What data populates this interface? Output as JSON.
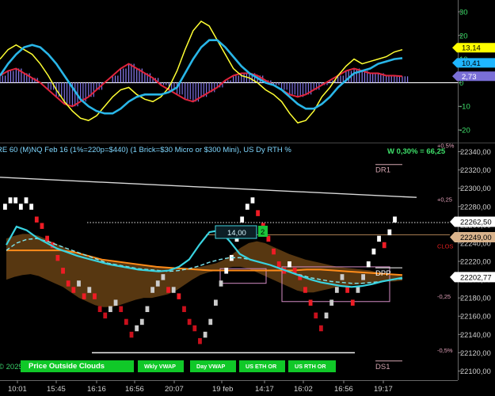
{
  "oscillator": {
    "y_ticks": [
      30,
      20,
      10,
      0,
      -10,
      -20
    ],
    "y_tick_labels": [
      "30",
      "20",
      "10",
      "0",
      "-10",
      "-20"
    ],
    "ylim": [
      -24,
      33
    ],
    "badges": [
      {
        "label": "13,14",
        "value": 13.14,
        "color": "#ffff00",
        "text_color": "#000000"
      },
      {
        "label": "10,41",
        "value": 10.41,
        "color": "#1fb6ff",
        "text_color": "#000000"
      },
      {
        "label": "2,73",
        "value": 2.73,
        "color": "#7a6fd6",
        "text_color": "#ffffff"
      }
    ]
  },
  "price_chart": {
    "title": "RE 60 (M)NQ Feb 16  (1%=220p=$440) (1 Brick=$30 Micro or $300 Mini), US Dy RTH %",
    "stat": "W 0,30% = 66,25",
    "y_ticks": [
      22340,
      22320,
      22300,
      22280,
      22260,
      22240,
      22220,
      22200,
      22180,
      22160,
      22140,
      22120,
      22100
    ],
    "y_tick_labels": [
      "22340,00",
      "22320,00",
      "22300,00",
      "22280,00",
      "22260,00",
      "22240,00",
      "22220,00",
      "22200,00",
      "22180,00",
      "22160,00",
      "22140,00",
      "22120,00",
      "22100,00"
    ],
    "ylim": [
      22090,
      22350
    ],
    "price_badges": [
      {
        "label": "22262,50",
        "value": 22262.5,
        "color": "#ffffff",
        "text_color": "#000000"
      },
      {
        "label": "22249,00",
        "value": 22249,
        "color": "#d9b38c",
        "text_color": "#000000"
      },
      {
        "label": "22202,77",
        "value": 22202.77,
        "color": "#ffffff",
        "text_color": "#000000"
      }
    ],
    "levels": [
      {
        "label": "DR1",
        "value": 22326,
        "color": "#d4a5b0"
      },
      {
        "label": "DPP",
        "value": 22213,
        "color": "#ffffff"
      },
      {
        "label": "DS1",
        "value": 22111,
        "color": "#d4a5b0"
      }
    ],
    "pct_labels": [
      {
        "label": "+0,5%",
        "value": 22347
      },
      {
        "label": "+0,25",
        "value": 22288
      },
      {
        "label": "CLOS",
        "value": 22237
      },
      {
        "label": "-0,25",
        "value": 22182
      },
      {
        "label": "-0,5%",
        "value": 22123
      }
    ],
    "box_label": "14,00",
    "green_tag": "2",
    "watermark": "© 2025 Ninja Trader, LLC"
  },
  "time_axis": [
    "10:01",
    "15:45",
    "16:16",
    "16:56",
    "20:07",
    "19 feb",
    "14:17",
    "16:02",
    "16:56",
    "19:17"
  ],
  "bottom_buttons": [
    "Price Outside Clouds",
    "Wkly VWAP",
    "Day VWAP",
    "US ETH OR",
    "US RTH OR"
  ],
  "chart_data": [
    {
      "type": "line",
      "title": "",
      "x": [
        0,
        1,
        2,
        3,
        4,
        5,
        6,
        7,
        8,
        9,
        10,
        11,
        12,
        13,
        14,
        15,
        16,
        17,
        18,
        19,
        20,
        21,
        22,
        23,
        24,
        25,
        26,
        27,
        28,
        29,
        30,
        31,
        32,
        33,
        34,
        35,
        36,
        37,
        38,
        39,
        40,
        41,
        42,
        43,
        44,
        45,
        46,
        47,
        48,
        49,
        50
      ],
      "series": [
        {
          "name": "",
          "color": "#ffff33",
          "values": [
            10,
            14,
            16,
            14,
            12,
            8,
            3,
            -3,
            -8,
            -12,
            -15,
            -16,
            -14,
            -10,
            -6,
            -3,
            -2,
            -5,
            -7,
            -8,
            -6,
            -2,
            5,
            14,
            22,
            26,
            24,
            18,
            12,
            6,
            3,
            2,
            0,
            -3,
            -5,
            -8,
            -13,
            -17,
            -16,
            -12,
            -6,
            -2,
            3,
            7,
            10,
            8,
            9,
            10,
            11,
            13,
            14
          ]
        },
        {
          "name": "",
          "color": "#29b6e8",
          "values": [
            3,
            8,
            12,
            15,
            16,
            15,
            12,
            8,
            3,
            -2,
            -7,
            -10,
            -12,
            -13,
            -13,
            -11,
            -8,
            -6,
            -5,
            -5,
            -5,
            -4,
            -2,
            4,
            10,
            15,
            18,
            18,
            15,
            11,
            7,
            4,
            2,
            0,
            -1,
            -3,
            -6,
            -9,
            -11,
            -11,
            -9,
            -6,
            -2,
            1,
            4,
            5,
            6,
            8,
            9,
            10,
            10.4
          ]
        }
      ],
      "histogram": [
        3,
        5,
        6,
        4,
        2,
        0,
        -3,
        -6,
        -9,
        -10,
        -8,
        -6,
        -3,
        0,
        3,
        6,
        8,
        6,
        4,
        2,
        -1,
        -3,
        -5,
        -7,
        -8,
        -6,
        -4,
        -2,
        1,
        3,
        4,
        4,
        3,
        1,
        -1,
        -3,
        -5,
        -6,
        -5,
        -3,
        -1,
        1,
        3,
        5,
        6,
        5,
        4,
        4,
        3,
        3,
        2.7
      ],
      "ylim": [
        -24,
        33
      ]
    },
    {
      "type": "renko",
      "title": "RE 60 (M)NQ Feb 16  (1%=220p=$440) (1 Brick=$30 Micro or $300 Mini), US Dy RTH %",
      "brick_size": 7,
      "bricks": [
        {
          "x": 0,
          "low": 22276,
          "dir": "up"
        },
        {
          "x": 1,
          "low": 22283,
          "dir": "up"
        },
        {
          "x": 2,
          "low": 22283,
          "dir": "up"
        },
        {
          "x": 3,
          "low": 22276,
          "dir": "up"
        },
        {
          "x": 4,
          "low": 22283,
          "dir": "up"
        },
        {
          "x": 5,
          "low": 22276,
          "dir": "up"
        },
        {
          "x": 6,
          "low": 22262,
          "dir": "down"
        },
        {
          "x": 7,
          "low": 22255,
          "dir": "down"
        },
        {
          "x": 8,
          "low": 22241,
          "dir": "down"
        },
        {
          "x": 9,
          "low": 22234,
          "dir": "down"
        },
        {
          "x": 10,
          "low": 22220,
          "dir": "down"
        },
        {
          "x": 11,
          "low": 22206,
          "dir": "down"
        },
        {
          "x": 12,
          "low": 22192,
          "dir": "down"
        },
        {
          "x": 13,
          "low": 22185,
          "dir": "down"
        },
        {
          "x": 14,
          "low": 22192,
          "dir": "up"
        },
        {
          "x": 15,
          "low": 22178,
          "dir": "down"
        },
        {
          "x": 16,
          "low": 22185,
          "dir": "up"
        },
        {
          "x": 17,
          "low": 22178,
          "dir": "down"
        },
        {
          "x": 18,
          "low": 22164,
          "dir": "down"
        },
        {
          "x": 19,
          "low": 22157,
          "dir": "down"
        },
        {
          "x": 20,
          "low": 22164,
          "dir": "up"
        },
        {
          "x": 21,
          "low": 22171,
          "dir": "up"
        },
        {
          "x": 22,
          "low": 22164,
          "dir": "down"
        },
        {
          "x": 23,
          "low": 22150,
          "dir": "down"
        },
        {
          "x": 24,
          "low": 22136,
          "dir": "down"
        },
        {
          "x": 25,
          "low": 22143,
          "dir": "up"
        },
        {
          "x": 26,
          "low": 22150,
          "dir": "up"
        },
        {
          "x": 27,
          "low": 22164,
          "dir": "up"
        },
        {
          "x": 28,
          "low": 22185,
          "dir": "up"
        },
        {
          "x": 29,
          "low": 22192,
          "dir": "up"
        },
        {
          "x": 30,
          "low": 22199,
          "dir": "up"
        },
        {
          "x": 31,
          "low": 22185,
          "dir": "down"
        },
        {
          "x": 32,
          "low": 22185,
          "dir": "up"
        },
        {
          "x": 33,
          "low": 22178,
          "dir": "down"
        },
        {
          "x": 34,
          "low": 22164,
          "dir": "down"
        },
        {
          "x": 35,
          "low": 22150,
          "dir": "down"
        },
        {
          "x": 36,
          "low": 22143,
          "dir": "down"
        },
        {
          "x": 37,
          "low": 22129,
          "dir": "down"
        },
        {
          "x": 38,
          "low": 22136,
          "dir": "up"
        },
        {
          "x": 39,
          "low": 22150,
          "dir": "up"
        },
        {
          "x": 40,
          "low": 22171,
          "dir": "up"
        },
        {
          "x": 41,
          "low": 22192,
          "dir": "up"
        },
        {
          "x": 42,
          "low": 22206,
          "dir": "up"
        },
        {
          "x": 43,
          "low": 22220,
          "dir": "up"
        },
        {
          "x": 44,
          "low": 22241,
          "dir": "up"
        },
        {
          "x": 45,
          "low": 22262,
          "dir": "up"
        },
        {
          "x": 46,
          "low": 22276,
          "dir": "up"
        },
        {
          "x": 47,
          "low": 22283,
          "dir": "up"
        },
        {
          "x": 48,
          "low": 22269,
          "dir": "down"
        },
        {
          "x": 49,
          "low": 22255,
          "dir": "down"
        },
        {
          "x": 50,
          "low": 22241,
          "dir": "down"
        },
        {
          "x": 51,
          "low": 22227,
          "dir": "down"
        },
        {
          "x": 52,
          "low": 22213,
          "dir": "down"
        },
        {
          "x": 53,
          "low": 22206,
          "dir": "down"
        },
        {
          "x": 54,
          "low": 22213,
          "dir": "up"
        },
        {
          "x": 55,
          "low": 22206,
          "dir": "down"
        },
        {
          "x": 56,
          "low": 22199,
          "dir": "down"
        },
        {
          "x": 57,
          "low": 22185,
          "dir": "down"
        },
        {
          "x": 58,
          "low": 22171,
          "dir": "down"
        },
        {
          "x": 59,
          "low": 22157,
          "dir": "down"
        },
        {
          "x": 60,
          "low": 22143,
          "dir": "down"
        },
        {
          "x": 61,
          "low": 22157,
          "dir": "up"
        },
        {
          "x": 62,
          "low": 22171,
          "dir": "up"
        },
        {
          "x": 63,
          "low": 22185,
          "dir": "up"
        },
        {
          "x": 64,
          "low": 22199,
          "dir": "up"
        },
        {
          "x": 65,
          "low": 22185,
          "dir": "down"
        },
        {
          "x": 66,
          "low": 22171,
          "dir": "down"
        },
        {
          "x": 67,
          "low": 22185,
          "dir": "up"
        },
        {
          "x": 68,
          "low": 22199,
          "dir": "up"
        },
        {
          "x": 69,
          "low": 22213,
          "dir": "up"
        },
        {
          "x": 70,
          "low": 22227,
          "dir": "up"
        },
        {
          "x": 71,
          "low": 22241,
          "dir": "up"
        },
        {
          "x": 72,
          "low": 22234,
          "dir": "down"
        },
        {
          "x": 73,
          "low": 22248,
          "dir": "up"
        },
        {
          "x": 74,
          "low": 22262,
          "dir": "up"
        }
      ],
      "cloud_upper": [
        22245,
        22248,
        22250,
        22250,
        22248,
        22244,
        22240,
        22236,
        22232,
        22228,
        22226,
        22224,
        22222,
        22220,
        22219,
        22218,
        22217,
        22216,
        22215,
        22214,
        22213,
        22212,
        22212,
        22213,
        22214,
        22216,
        22218,
        22222,
        22228,
        22235,
        22240,
        22242,
        22240,
        22236,
        22232,
        22228,
        22225,
        22222,
        22220,
        22218,
        22216,
        22214,
        22213,
        22212,
        22211,
        22210,
        22208,
        22207,
        22206,
        22205
      ],
      "cloud_lower": [
        22200,
        22203,
        22205,
        22206,
        22204,
        22200,
        22196,
        22192,
        22186,
        22180,
        22176,
        22172,
        22170,
        22170,
        22172,
        22175,
        22178,
        22180,
        22180,
        22182,
        22184,
        22188,
        22194,
        22200,
        22205,
        22208,
        22210,
        22212,
        22214,
        22214,
        22212,
        22208,
        22204,
        22200,
        22196,
        22192,
        22188,
        22186,
        22186,
        22188,
        22190,
        22192,
        22193,
        22194,
        22195,
        22196,
        22197,
        22198,
        22198,
        22199
      ],
      "cyan_ma": [
        22238,
        22258,
        22254,
        22246,
        22240,
        22234,
        22230,
        22226,
        22223,
        22220,
        22217,
        22215,
        22213,
        22211,
        22210,
        22209,
        22210,
        22214,
        22222,
        22238,
        22252,
        22254,
        22242,
        22228,
        22222,
        22219,
        22216,
        22212,
        22208,
        22204,
        22200,
        22197,
        22195,
        22193,
        22192,
        22193,
        22195,
        22198,
        22200,
        22202
      ],
      "dashed_ma": [
        22232,
        22240,
        22244,
        22245,
        22242,
        22238,
        22234,
        22230,
        22226,
        22222,
        22218,
        22216,
        22214,
        22212,
        22211,
        22210,
        22209,
        22210,
        22212,
        22215,
        22219,
        22222,
        22224,
        22224,
        22222,
        22219,
        22216,
        22212,
        22208,
        22205,
        22202,
        22200,
        22198,
        22197,
        22196,
        22196,
        22197,
        22198,
        22200,
        22201
      ],
      "orange_vwap": [
        22232,
        22232,
        22232,
        22232,
        22232,
        22230,
        22226,
        22222,
        22220,
        22218,
        22216,
        22214,
        22213,
        22212,
        22211,
        22210,
        22210,
        22210,
        22210,
        22210,
        22210,
        22210,
        22211,
        22211,
        22210,
        22209,
        22208,
        22207,
        22206,
        22205
      ],
      "white_line": [
        22312,
        22290
      ],
      "dotted_level": 22262.5,
      "low_line": 22120,
      "ylim": [
        22090,
        22350
      ]
    }
  ]
}
